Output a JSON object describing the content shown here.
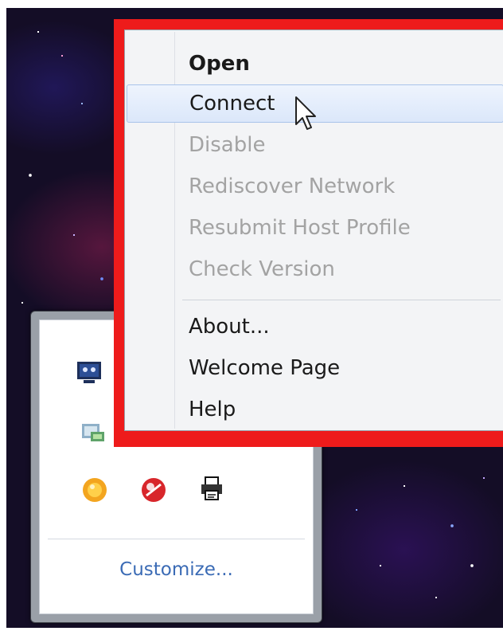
{
  "context_menu": {
    "items": [
      {
        "label": "Open",
        "bold": true,
        "enabled": true
      },
      {
        "label": "Connect",
        "bold": false,
        "enabled": true,
        "hovered": true
      },
      {
        "label": "Disable",
        "bold": false,
        "enabled": false
      },
      {
        "label": "Rediscover Network",
        "bold": false,
        "enabled": false
      },
      {
        "label": "Resubmit Host Profile",
        "bold": false,
        "enabled": false
      },
      {
        "label": "Check Version",
        "bold": false,
        "enabled": false
      },
      {
        "label": "About...",
        "bold": false,
        "enabled": true
      },
      {
        "label": "Welcome Page",
        "bold": false,
        "enabled": true
      },
      {
        "label": "Help",
        "bold": false,
        "enabled": true
      }
    ]
  },
  "tray_panel": {
    "icons": [
      "network-monitor-icon",
      "network-adapter-icon",
      "orange-status-icon",
      "red-security-icon",
      "printer-icon"
    ],
    "customize_label": "Customize..."
  },
  "colors": {
    "highlight_frame": "#ee1b1b",
    "menu_background": "#f3f4f6",
    "hover_fill": "#dbe7fa",
    "disabled_text": "#a3a3a3",
    "link": "#3b6bb5"
  }
}
